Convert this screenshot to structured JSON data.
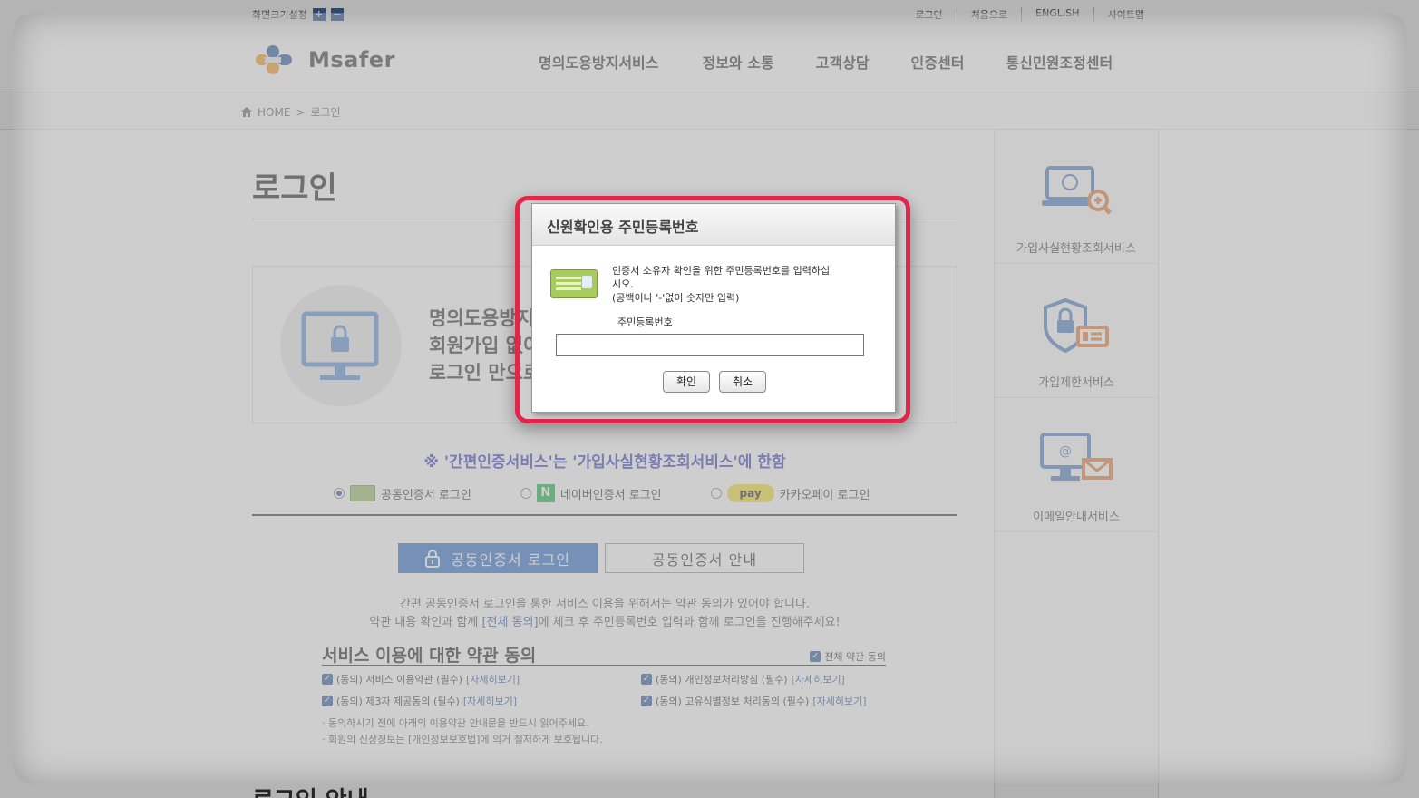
{
  "util": {
    "font_size_label": "화면크기설정",
    "plus": "+",
    "minus": "−",
    "links": [
      "로그인",
      "처음으로",
      "ENGLISH",
      "사이트맵"
    ]
  },
  "header": {
    "logo_text": "Msafer",
    "nav": [
      "명의도용방지서비스",
      "정보와 소통",
      "고객상담",
      "인증센터",
      "통신민원조정센터"
    ]
  },
  "breadcrumb": {
    "home": "HOME",
    "sep": ">",
    "current": "로그인"
  },
  "main": {
    "title": "로그인",
    "intro_lines": [
      "명의도용방지",
      "회원가입 없이",
      "로그인 만으로"
    ],
    "notice": "※ '간편인증서비스'는 '가입사실현황조회서비스'에 한함",
    "login_options": [
      {
        "label": "공동인증서 로그인",
        "selected": true
      },
      {
        "label": "네이버인증서 로그인",
        "icon_text": "N",
        "selected": false
      },
      {
        "label": "카카오페이 로그인",
        "icon_text": "pay",
        "selected": false
      }
    ],
    "btn_login": "공동인증서 로그인",
    "btn_guide": "공동인증서 안내",
    "desc_line1": "간편 공동인증서 로그인을 통한 서비스 이용을 위해서는 약관 동의가 있어야 합니다.",
    "desc_line2_pre": "약관 내용 확인과 함께 ",
    "desc_line2_link": "[전체 동의]",
    "desc_line2_post": "에 체크 후 주민등록번호 입력과 함께 로그인을 진행해주세요!",
    "terms_title": "서비스 이용에 대한 약관 동의",
    "terms_all": "전체 약관 동의",
    "terms": [
      {
        "label": "(동의) 서비스 이용약관 (필수)",
        "link": "[자세히보기]"
      },
      {
        "label": "(동의) 개인정보처리방침 (필수)",
        "link": "[자세히보기]"
      },
      {
        "label": "(동의) 제3자 제공동의 (필수)",
        "link": "[자세히보기]"
      },
      {
        "label": "(동의) 고유식별정보 처리동의 (필수)",
        "link": "[자세히보기]"
      }
    ],
    "notes": [
      "· 동의하시기 전에 아래의 이용약관 안내문을 반드시 읽어주세요.",
      "· 회원의 신상정보는 [개인정보보호법]에 의거 철저하게 보호됩니다."
    ],
    "bottom_title": "로그인 안내"
  },
  "side": [
    {
      "label": "가입사실현황조회서비스",
      "icon": "monitor-search-icon"
    },
    {
      "label": "가입제한서비스",
      "icon": "shield-lock-icon"
    },
    {
      "label": "이메일안내서비스",
      "icon": "monitor-mail-icon"
    }
  ],
  "modal": {
    "title": "신원확인용 주민등록번호",
    "message_line1": "인증서 소유자 확인을 위한 주민등록번호를 입력하십",
    "message_line2": "시오.",
    "message_line3": "(공백이나 '-'없이 숫자만 입력)",
    "field_label": "주민등록번호",
    "field_value": "",
    "ok": "확인",
    "cancel": "취소"
  },
  "colors": {
    "accent_blue": "#2f6fcd",
    "highlight_red": "#e0264a",
    "notice_purple": "#3b3fbf"
  }
}
